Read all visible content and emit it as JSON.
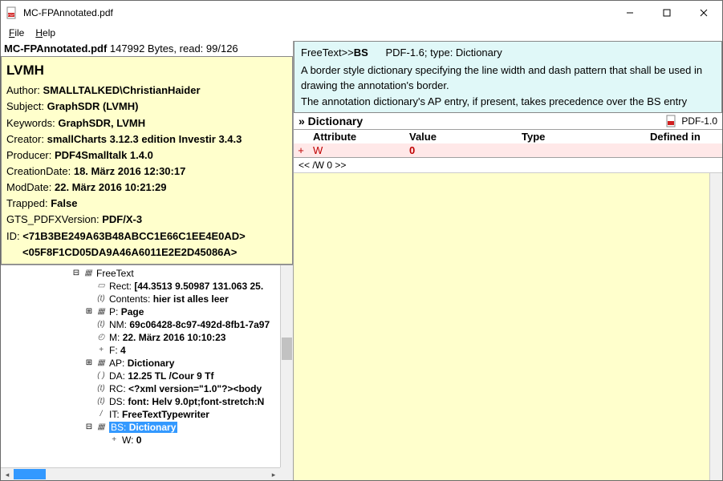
{
  "window": {
    "title": "MC-FPAnnotated.pdf"
  },
  "menu": {
    "file": "File",
    "help": "Help"
  },
  "file_header": {
    "name": "MC-FPAnnotated.pdf",
    "detail": "147992 Bytes, read: 99/126"
  },
  "doc": {
    "title": "LVMH",
    "author_label": "Author:",
    "author": "SMALLTALKED\\ChristianHaider",
    "subject_label": "Subject:",
    "subject": "GraphSDR (LVMH)",
    "keywords_label": "Keywords:",
    "keywords": "GraphSDR, LVMH",
    "creator_label": "Creator:",
    "creator": "smallCharts 3.12.3 edition Investir 3.4.3",
    "producer_label": "Producer:",
    "producer": "PDF4Smalltalk 1.4.0",
    "creation_label": "CreationDate:",
    "creation": "18. März 2016 12:30:17",
    "moddate_label": "ModDate:",
    "moddate": "22. März 2016 10:21:29",
    "trapped_label": "Trapped:",
    "trapped": "False",
    "gts_label": "GTS_PDFXVersion:",
    "gts": "PDF/X-3",
    "id_label": "ID:",
    "id1": "<71B3BE249A63B48ABCC1E66C1EE4E0AD>",
    "id2": "<05F8F1CD05DA9A46A6011E2E2D45086A>"
  },
  "tree": {
    "freetext": "FreeText",
    "rect_label": "Rect:",
    "rect_val": "[44.3513 9.50987 131.063 25.",
    "contents_label": "Contents:",
    "contents_val": "hier ist alles leer",
    "p_label": "P:",
    "p_val": "Page",
    "nm_label": "NM:",
    "nm_val": "69c06428-8c97-492d-8fb1-7a97",
    "m_label": "M:",
    "m_val": "22. März 2016 10:10:23",
    "f_label": "F:",
    "f_val": "4",
    "ap_label": "AP:",
    "ap_val": "Dictionary",
    "da_label": "DA:",
    "da_val": "12.25 TL /Cour 9 Tf",
    "rc_label": "RC:",
    "rc_val": "<?xml version=\"1.0\"?><body",
    "ds_label": "DS:",
    "ds_val": "font: Helv 9.0pt;font-stretch:N",
    "it_label": "IT:",
    "it_val": "FreeTextTypewriter",
    "bs_label": "BS:",
    "bs_val": "Dictionary",
    "w_label": "W:",
    "w_val": "0"
  },
  "desc": {
    "crumb_prefix": "FreeText>>",
    "crumb_name": "BS",
    "crumb_suffix": "PDF-1.6; type: Dictionary",
    "line1": "A border style dictionary specifying the line width and dash pattern that shall be used in drawing the annotation's border.",
    "line2": "The annotation dictionary's AP entry, if present, takes precedence over the BS entry"
  },
  "dict": {
    "heading": "» Dictionary",
    "pdfver": "PDF-1.0",
    "cols": {
      "attribute": "Attribute",
      "value": "Value",
      "type": "Type",
      "defined": "Defined in"
    },
    "row": {
      "exp": "+",
      "attr": "W",
      "val": "0",
      "type": "",
      "defined": ""
    }
  },
  "nav": {
    "text": "<<   /W 0    >>"
  }
}
